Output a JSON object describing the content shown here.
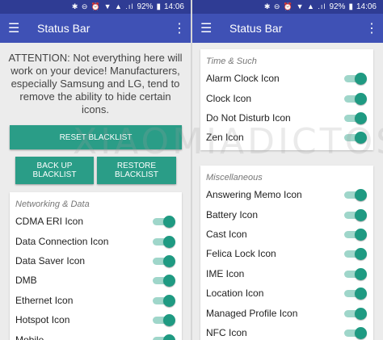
{
  "left": {
    "status": {
      "icons": "✱ ⊖ ⏰ ▼ ▲ .ıl",
      "battery": "92%",
      "time": "14:06"
    },
    "appbar": {
      "title": "Status Bar"
    },
    "notice": "ATTENTION: Not everything here will work on your device! Manufacturers, especially Samsung and LG, tend to remove the ability to hide certain icons.",
    "buttons": {
      "reset": "RESET BLACKLIST",
      "backup": "BACK UP BLACKLIST",
      "restore": "RESTORE BLACKLIST"
    },
    "section": "Networking & Data",
    "items": [
      {
        "label": "CDMA ERI Icon",
        "on": true
      },
      {
        "label": "Data Connection Icon",
        "on": true
      },
      {
        "label": "Data Saver Icon",
        "on": true
      },
      {
        "label": "DMB",
        "on": true
      },
      {
        "label": "Ethernet Icon",
        "on": true
      },
      {
        "label": "Hotspot Icon",
        "on": true
      },
      {
        "label": "Mobile",
        "on": true
      }
    ]
  },
  "right": {
    "status": {
      "icons": "✱ ⊖ ⏰ ▼ ▲ .ıl",
      "battery": "92%",
      "time": "14:06"
    },
    "appbar": {
      "title": "Status Bar"
    },
    "section1": "Time & Such",
    "items1": [
      {
        "label": "Alarm Clock Icon",
        "on": true
      },
      {
        "label": "Clock Icon",
        "on": true
      },
      {
        "label": "Do Not Disturb Icon",
        "on": true
      },
      {
        "label": "Zen Icon",
        "on": true
      }
    ],
    "section2": "Miscellaneous",
    "items2": [
      {
        "label": "Answering Memo Icon",
        "on": true
      },
      {
        "label": "Battery Icon",
        "on": true
      },
      {
        "label": "Cast Icon",
        "on": true
      },
      {
        "label": "Felica Lock Icon",
        "on": true
      },
      {
        "label": "IME Icon",
        "on": true
      },
      {
        "label": "Location Icon",
        "on": true
      },
      {
        "label": "Managed Profile Icon",
        "on": true
      },
      {
        "label": "NFC Icon",
        "on": true
      }
    ]
  },
  "watermark": "XIAOMIADICTOS",
  "colors": {
    "appbar": "#3f51b5",
    "statusbar": "#2f3c94",
    "accent": "#2a9d87",
    "toggle_thumb": "#1f9a82",
    "toggle_track": "#9fd6ca"
  }
}
